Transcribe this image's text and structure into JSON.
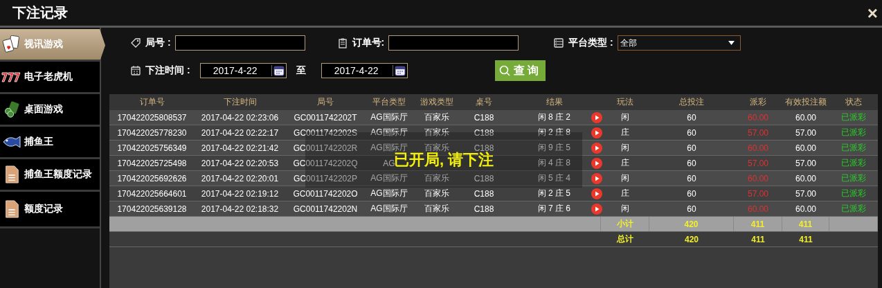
{
  "window": {
    "title": "下注记录",
    "close": "×"
  },
  "sidebar": {
    "items": [
      {
        "label": "视讯游戏",
        "kind": "cards",
        "selected": true
      },
      {
        "label": "电子老虎机",
        "kind": "slot",
        "selected": false
      },
      {
        "label": "桌面游戏",
        "kind": "chips",
        "selected": false
      },
      {
        "label": "捕鱼王",
        "kind": "fish",
        "selected": false
      },
      {
        "label": "捕鱼王额度记录",
        "kind": "doc",
        "selected": false
      },
      {
        "label": "额度记录",
        "kind": "doc",
        "selected": false
      }
    ]
  },
  "filters": {
    "round_label": "局号 :",
    "order_label": "订单号:",
    "platform_label": "平台类型 :",
    "platform_value": "全部",
    "time_label": "下注时间 :",
    "date_from": "2017-4-22",
    "to_label": "至",
    "date_to": "2017-4-22",
    "query_button": "查 询"
  },
  "table": {
    "columns": [
      "订单号",
      "下注时间",
      "局号",
      "平台类型",
      "游戏类型",
      "桌号",
      "结果",
      "玩法",
      "总投注",
      "派彩",
      "有效投注额",
      "状态"
    ],
    "rows": [
      [
        "170422025808537",
        "2017-04-22 02:23:06",
        "GC0011742202T",
        "AG国际厅",
        "百家乐",
        "C188",
        "闲 8 庄 2",
        "闲",
        "60",
        "60.00",
        "60.00",
        "已派彩"
      ],
      [
        "170422025778230",
        "2017-04-22 02:22:17",
        "GC0011742202S",
        "AG国际厅",
        "百家乐",
        "C188",
        "闲 2 庄 8",
        "庄",
        "60",
        "57.00",
        "57.00",
        "已派彩"
      ],
      [
        "170422025756349",
        "2017-04-22 02:21:42",
        "GC0011742202R",
        "AG国际厅",
        "百家乐",
        "C188",
        "闲 9 庄 5",
        "闲",
        "60",
        "60.00",
        "60.00",
        "已派彩"
      ],
      [
        "170422025725498",
        "2017-04-22 02:20:53",
        "GC0011742202Q",
        "AG",
        null,
        null,
        "闲 4 庄 8",
        "庄",
        "60",
        "57.00",
        "57.00",
        "已派彩"
      ],
      [
        "170422025692626",
        "2017-04-22 02:20:01",
        "GC0011742202P",
        "AG国际厅",
        "百家乐",
        "C188",
        "闲 5 庄 4",
        "闲",
        "60",
        "60.00",
        "60.00",
        "已派彩"
      ],
      [
        "170422025664601",
        "2017-04-22 02:19:12",
        "GC0011742202O",
        "AG国际厅",
        "百家乐",
        "C188",
        "闲 2 庄 5",
        "庄",
        "60",
        "57.00",
        "57.00",
        "已派彩"
      ],
      [
        "170422025639128",
        "2017-04-22 02:18:32",
        "GC0011742202N",
        "AG国际厅",
        "百家乐",
        "C188",
        "闲 7 庄 6",
        "闲",
        "60",
        "60.00",
        "60.00",
        "已派彩"
      ]
    ],
    "totals": [
      {
        "label": "小计",
        "bet": "420",
        "payout": "411",
        "valid": "411",
        "shaded": true
      },
      {
        "label": "总计",
        "bet": "420",
        "payout": "411",
        "valid": "411",
        "shaded": false
      }
    ]
  },
  "toast": "已开局, 请下注"
}
